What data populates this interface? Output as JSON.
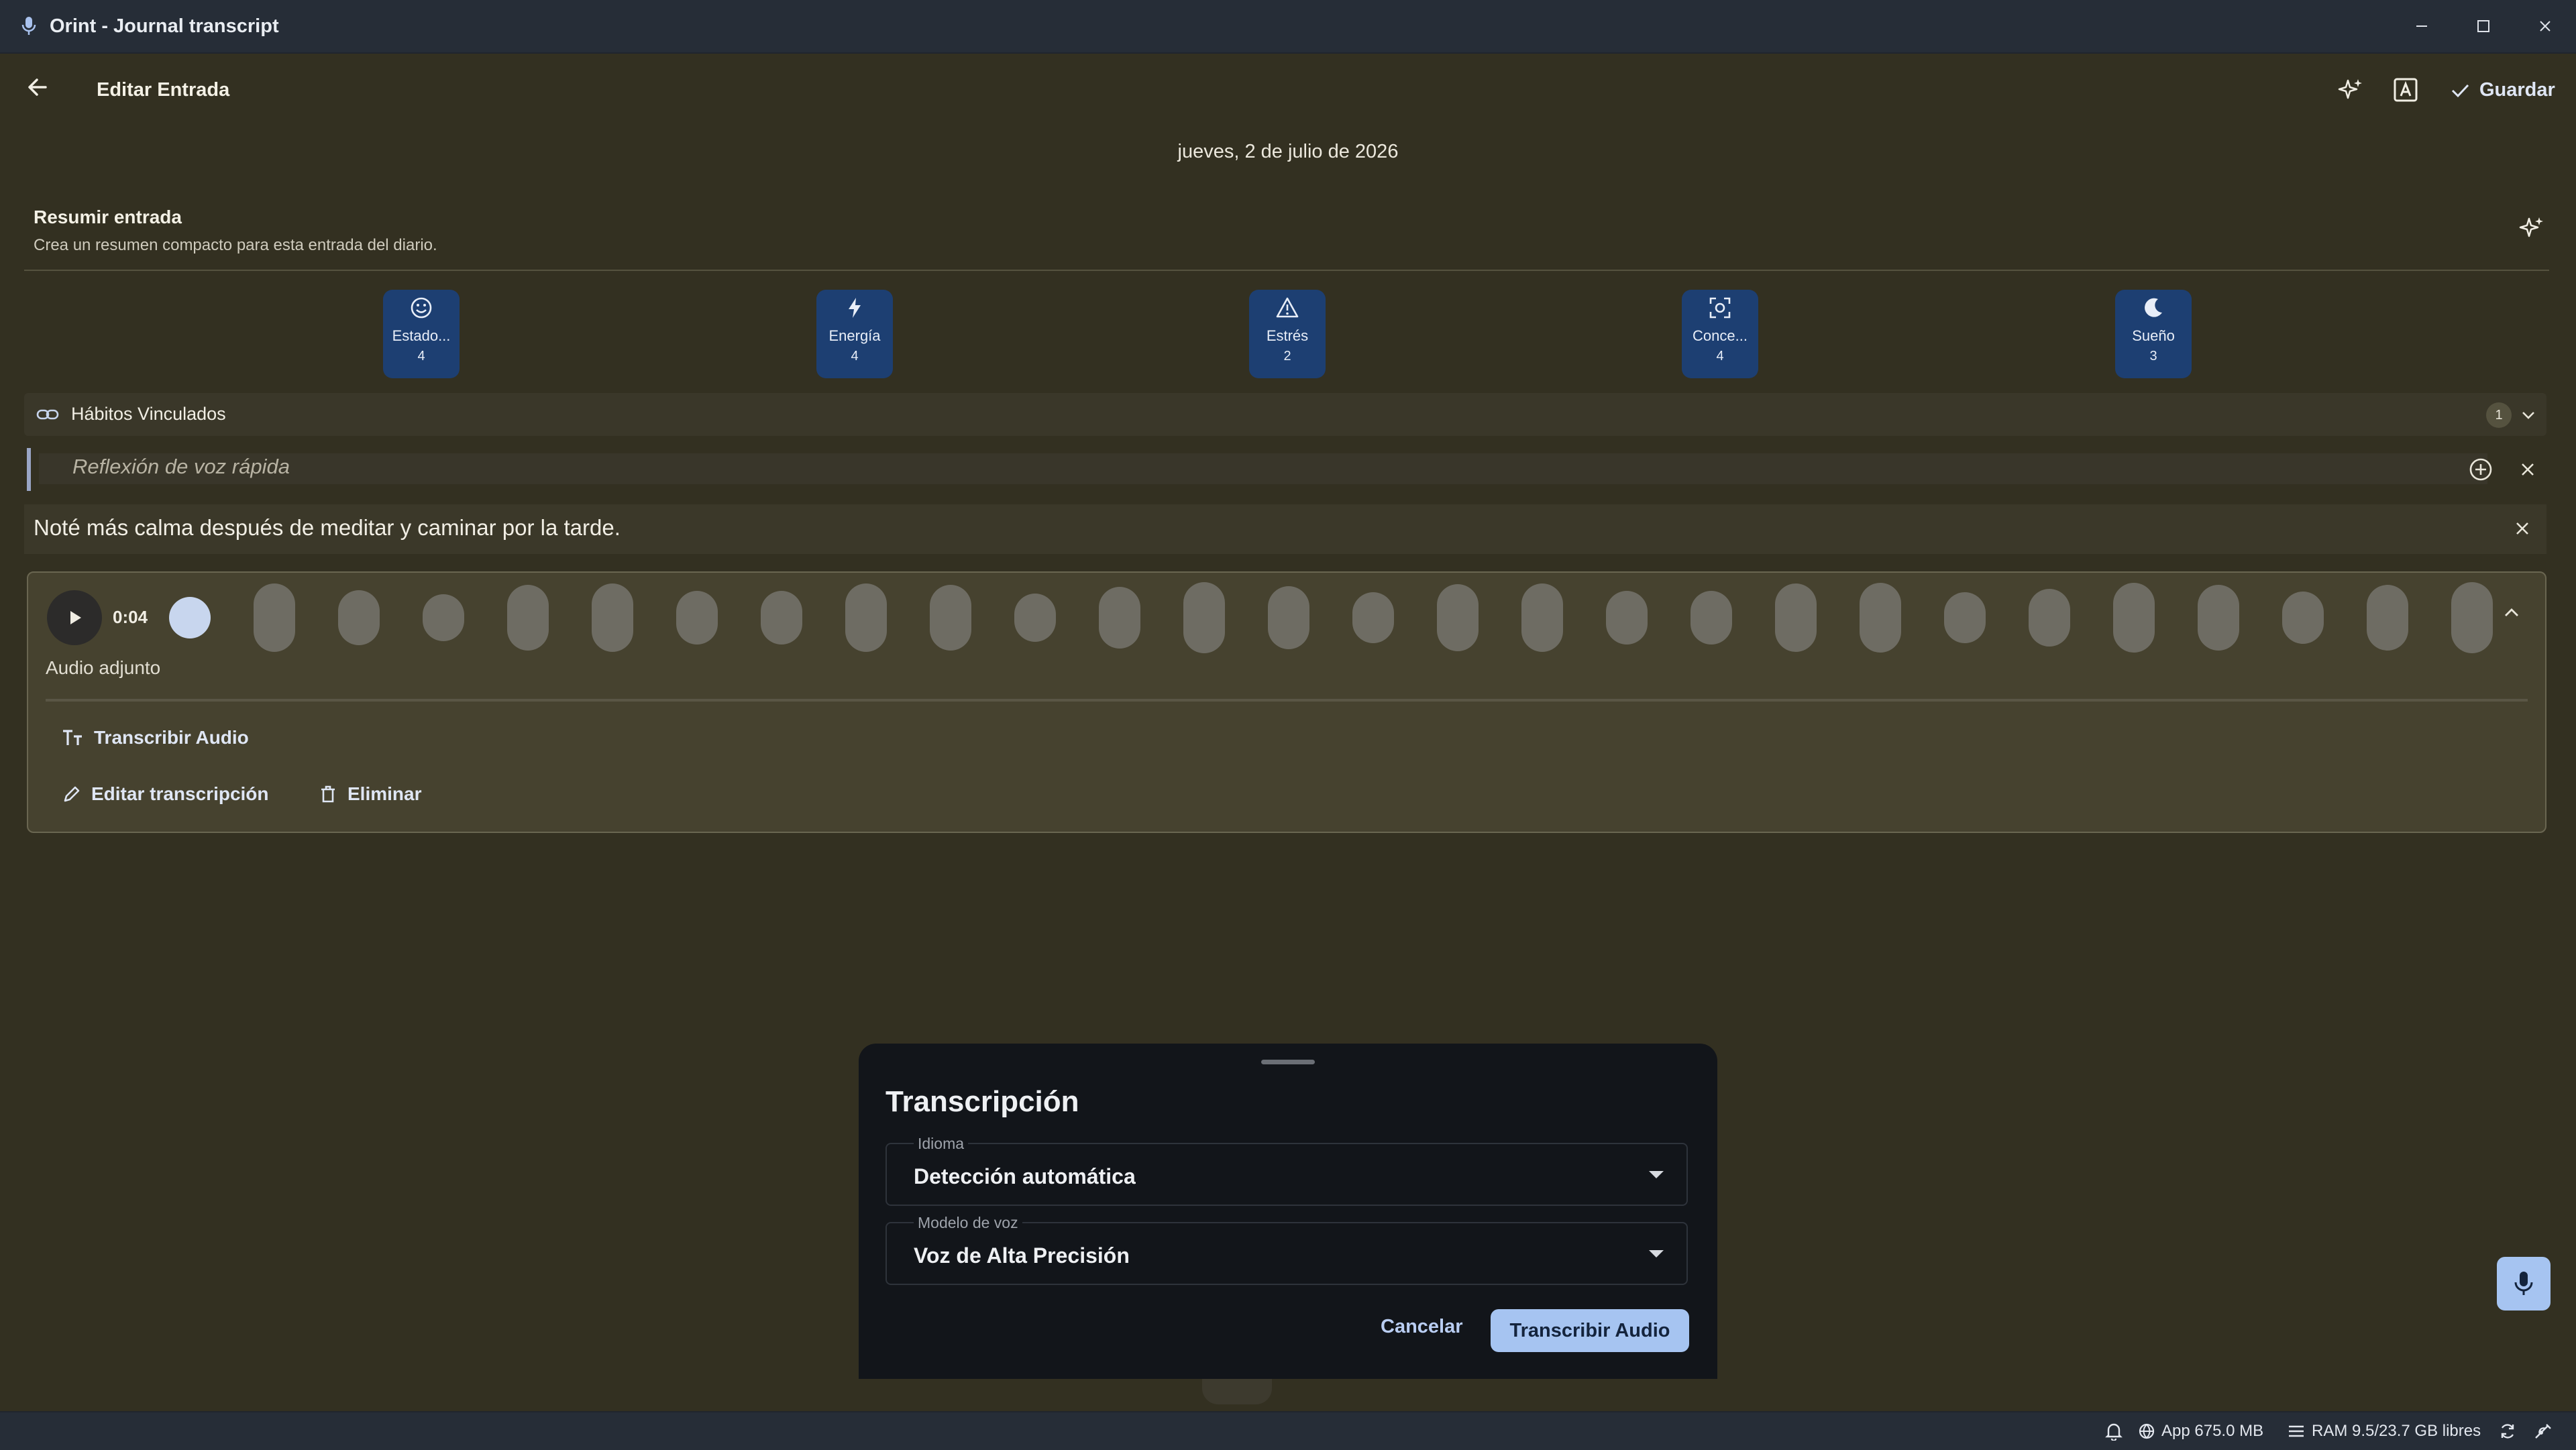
{
  "window": {
    "title": "Orint - Journal transcript",
    "controls": [
      "minimize-icon",
      "maximize-icon",
      "close-icon"
    ]
  },
  "header": {
    "title": "Editar Entrada",
    "save_label": "Guardar",
    "icons": [
      "back-arrow-icon",
      "ai-sparkle-icon",
      "text-format-icon",
      "check-icon"
    ]
  },
  "entry": {
    "date": "jueves, 2 de julio de 2026"
  },
  "summary": {
    "title": "Resumir entrada",
    "subtitle": "Crea un resumen compacto para esta entrada del diario."
  },
  "metrics": [
    {
      "label": "Estado...",
      "value": "4",
      "icon": "smile-icon"
    },
    {
      "label": "Energía",
      "value": "4",
      "icon": "bolt-icon"
    },
    {
      "label": "Estrés",
      "value": "2",
      "icon": "warning-icon"
    },
    {
      "label": "Conce...",
      "value": "4",
      "icon": "focus-icon"
    },
    {
      "label": "Sueño",
      "value": "3",
      "icon": "moon-icon"
    }
  ],
  "habits": {
    "label": "Hábitos Vinculados",
    "count": "1"
  },
  "quote": {
    "text": "Reflexión de voz rápida"
  },
  "note": {
    "text": "Noté más calma después de meditar y caminar por la tarde."
  },
  "audio": {
    "time": "0:04",
    "label": "Audio adjunto",
    "progress": 0.02,
    "actions": {
      "transcribe": "Transcribir Audio",
      "edit": "Editar transcripción",
      "delete": "Eliminar"
    }
  },
  "sheet": {
    "title": "Transcripción",
    "language_label": "Idioma",
    "language_value": "Detección automática",
    "model_label": "Modelo de voz",
    "model_value": "Voz de Alta Precisión",
    "cancel": "Cancelar",
    "confirm": "Transcribir Audio"
  },
  "status": {
    "app_memory": "App 675.0 MB",
    "ram": "RAM 9.5/23.7 GB libres"
  },
  "colors": {
    "background": "#333021",
    "accent": "#a6c4f1",
    "metric_tile": "#1d3f72",
    "sheet": "#12151a"
  }
}
